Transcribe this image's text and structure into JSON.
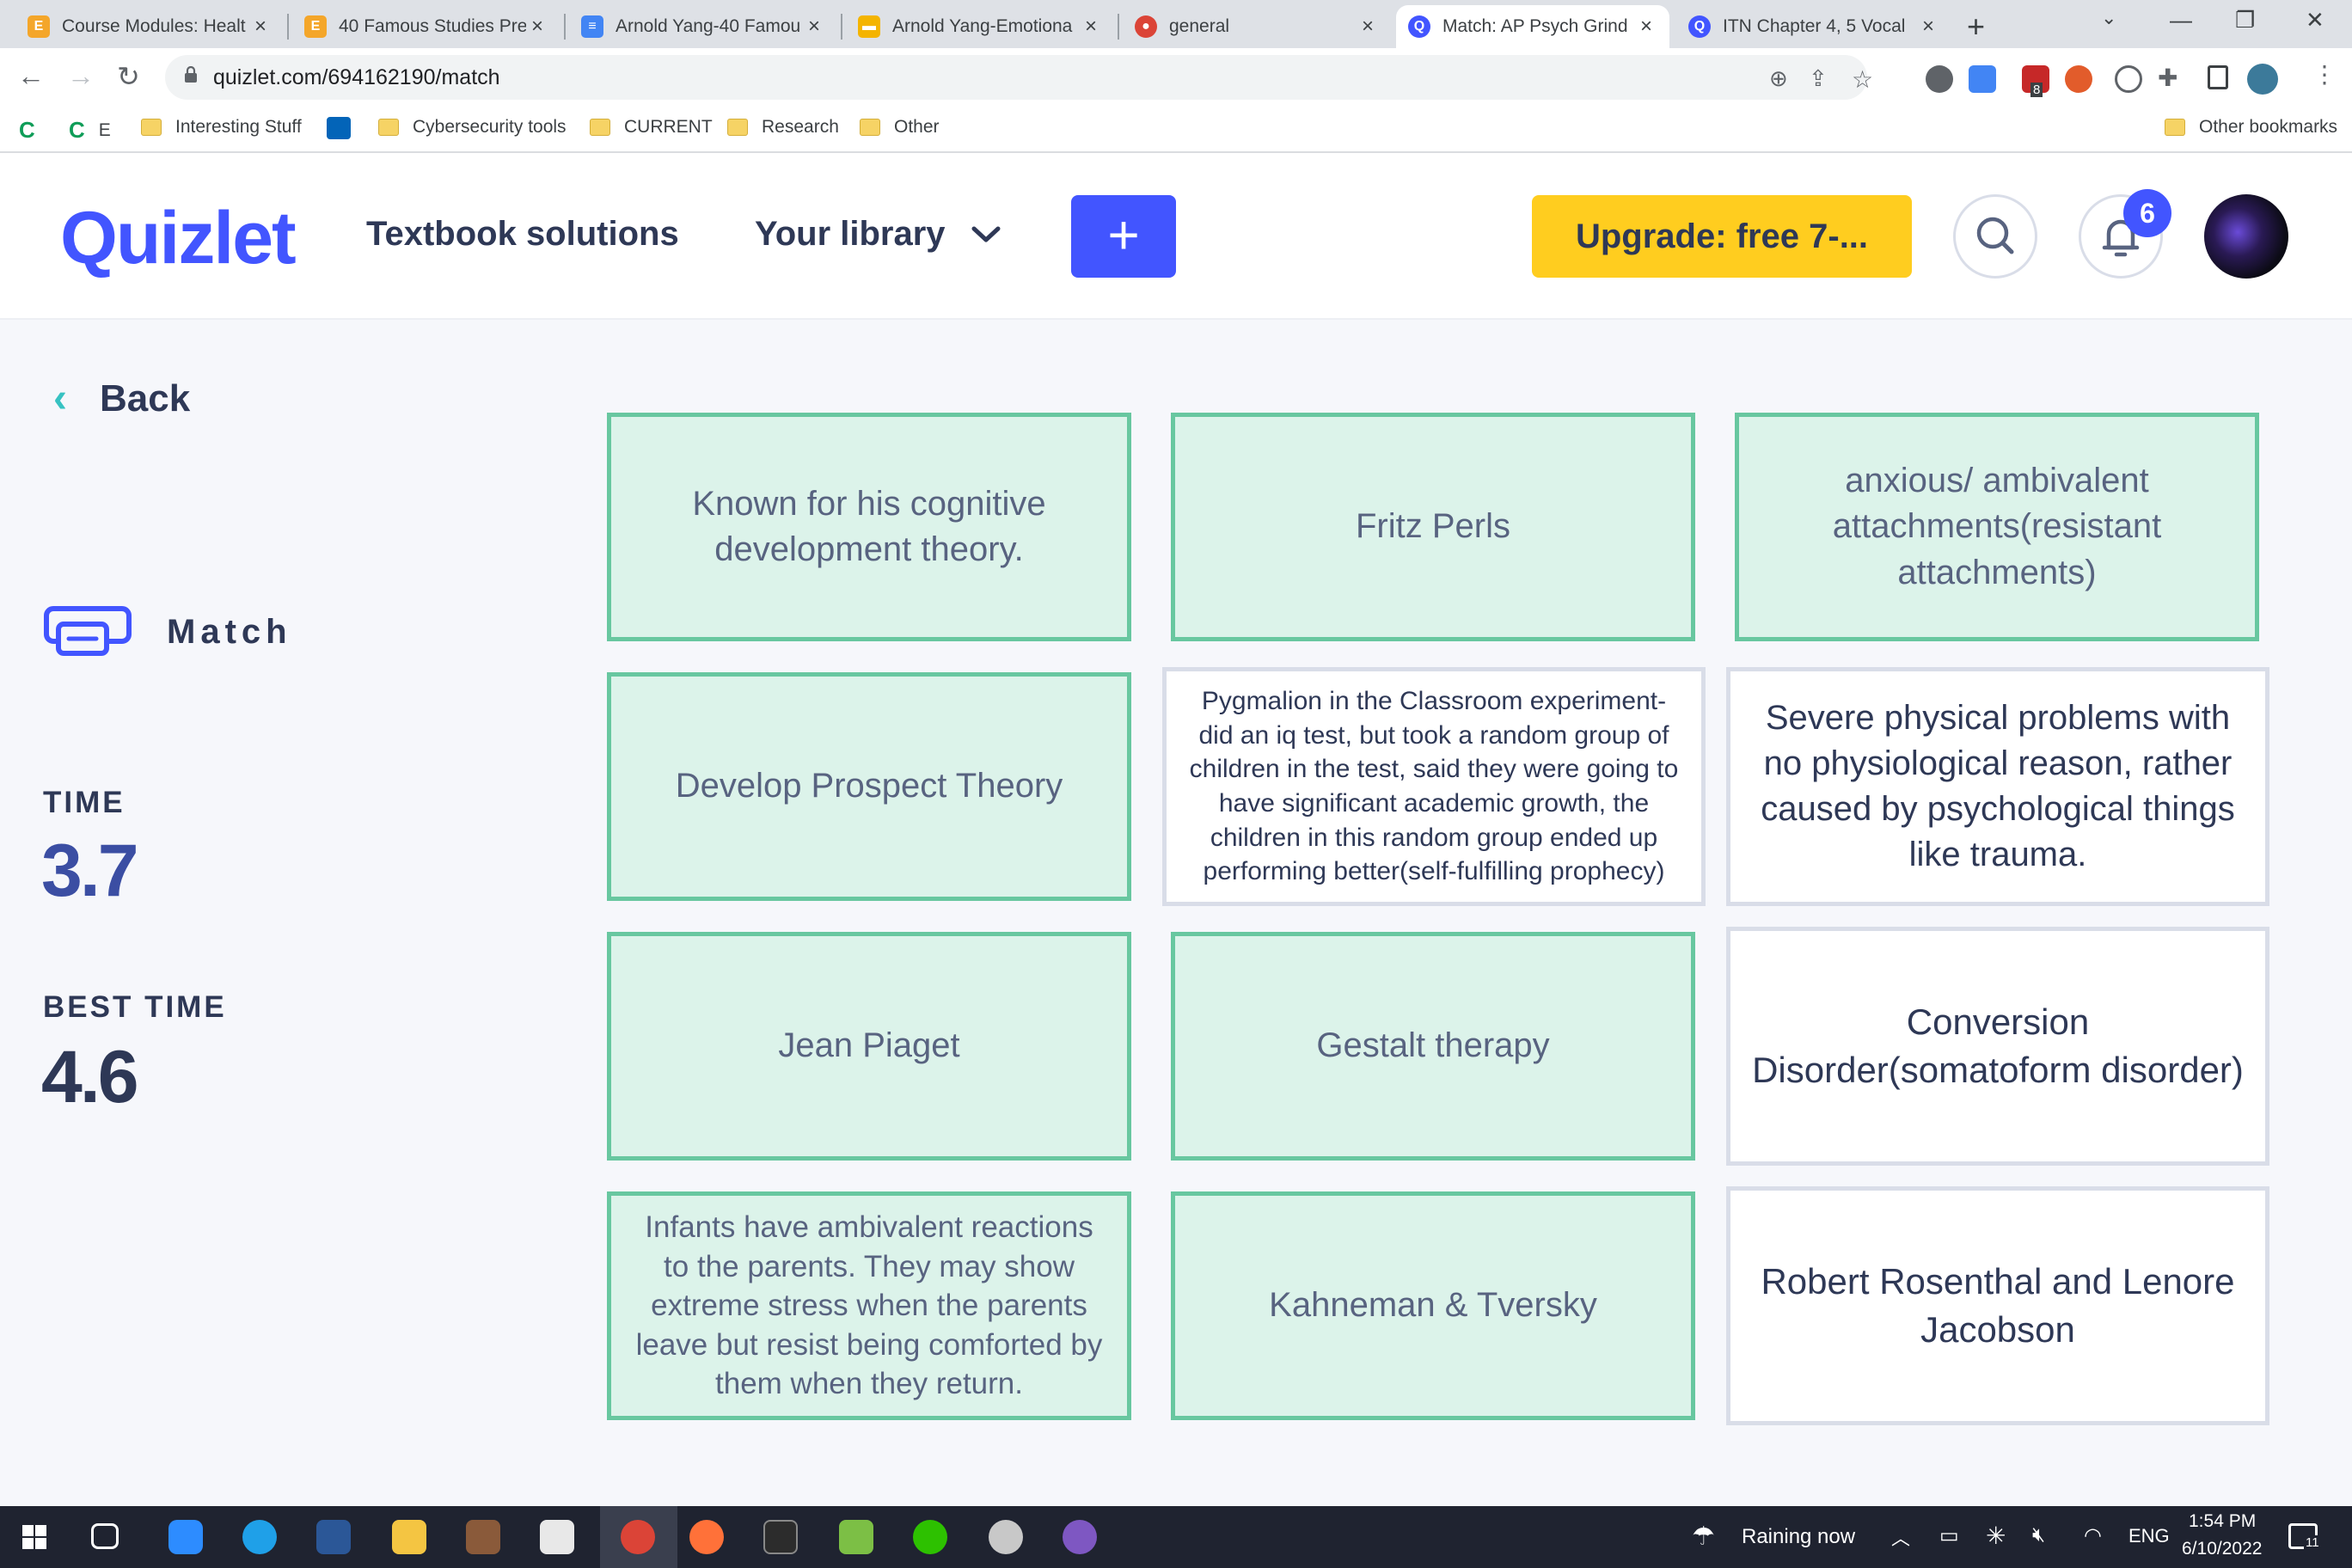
{
  "browser": {
    "tabs": [
      {
        "title": "Course Modules: Healt",
        "icon": "edgenuity-icon",
        "color": "#f4a62a"
      },
      {
        "title": "40 Famous Studies Pre",
        "icon": "edgenuity-icon",
        "color": "#f4a62a"
      },
      {
        "title": "Arnold Yang-40 Famou",
        "icon": "google-docs-icon",
        "color": "#4285f4"
      },
      {
        "title": "Arnold Yang-Emotiona",
        "icon": "google-slides-icon",
        "color": "#f4b400"
      },
      {
        "title": "general",
        "icon": "chat-app-icon",
        "color": "#db4437"
      },
      {
        "title": "Match: AP Psych Grind",
        "icon": "quizlet-icon",
        "color": "#4255ff"
      },
      {
        "title": "ITN Chapter 4, 5 Vocal",
        "icon": "quizlet-icon",
        "color": "#4255ff"
      }
    ],
    "url": "quizlet.com/694162190/match",
    "bookmarks": [
      "E",
      "Interesting Stuff",
      "Cybersecurity tools",
      "CURRENT",
      "Research",
      "Other"
    ],
    "other_bookmarks": "Other bookmarks",
    "extension_badge": "8"
  },
  "header": {
    "logo": "Quizlet",
    "textbook": "Textbook solutions",
    "library": "Your library",
    "upgrade": "Upgrade: free 7-...",
    "notification_count": "6",
    "accent": "#4255ff",
    "upgrade_color": "#ffcd1f"
  },
  "sidebar": {
    "back": "Back",
    "mode": "Match",
    "time_label": "TIME",
    "time_value": "3.7",
    "best_label": "BEST TIME",
    "best_value": "4.6"
  },
  "cards": [
    {
      "text": "Known for his cognitive development theory.",
      "matched": true
    },
    {
      "text": "Fritz Perls",
      "matched": true
    },
    {
      "text": "anxious/ ambivalent attachments(resistant attachments)",
      "matched": true
    },
    {
      "text": "Develop Prospect Theory",
      "matched": true
    },
    {
      "text": "Pygmalion in the Classroom experiment- did an iq test, but took a random group of children in the test, said they were going to have significant academic growth, the children in this random group ended up performing better(self-fulfilling prophecy)",
      "matched": false
    },
    {
      "text": "Severe physical problems with no physiological reason, rather caused by psychological things like trauma.",
      "matched": false
    },
    {
      "text": "Jean Piaget",
      "matched": true
    },
    {
      "text": "Gestalt therapy",
      "matched": true
    },
    {
      "text": "Conversion Disorder(somatoform disorder)",
      "matched": false
    },
    {
      "text": "Infants have ambivalent reactions to the parents. They may show extreme stress when the parents leave but resist being comforted by them when they return.",
      "matched": true
    },
    {
      "text": "Kahneman & Tversky",
      "matched": true
    },
    {
      "text": "Robert Rosenthal and Lenore Jacobson",
      "matched": false
    }
  ],
  "taskbar": {
    "weather": "Raining now",
    "language": "ENG",
    "time": "1:54 PM",
    "date": "6/10/2022",
    "notification_count": "11"
  }
}
